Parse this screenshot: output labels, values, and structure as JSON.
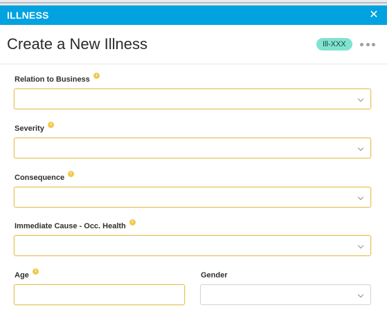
{
  "window": {
    "title": "ILLNESS",
    "close_symbol": "✕"
  },
  "header": {
    "heading": "Create a New Illness",
    "badge": "Ill-XXX"
  },
  "fields": [
    {
      "label": "Relation to Business",
      "required": true,
      "type": "select",
      "value": ""
    },
    {
      "label": "Severity",
      "required": true,
      "type": "select",
      "value": ""
    },
    {
      "label": "Consequence",
      "required": true,
      "type": "select",
      "value": ""
    },
    {
      "label": "Immediate Cause - Occ. Health",
      "required": true,
      "type": "select",
      "value": ""
    },
    {
      "label": "Age",
      "required": true,
      "type": "text",
      "value": ""
    },
    {
      "label": "Gender",
      "required": false,
      "type": "select",
      "value": ""
    }
  ],
  "colors": {
    "titlebar": "#00a3e0",
    "badge": "#7fe3cf",
    "required_border": "#e6c25a",
    "required_icon": "#f2c94c"
  }
}
